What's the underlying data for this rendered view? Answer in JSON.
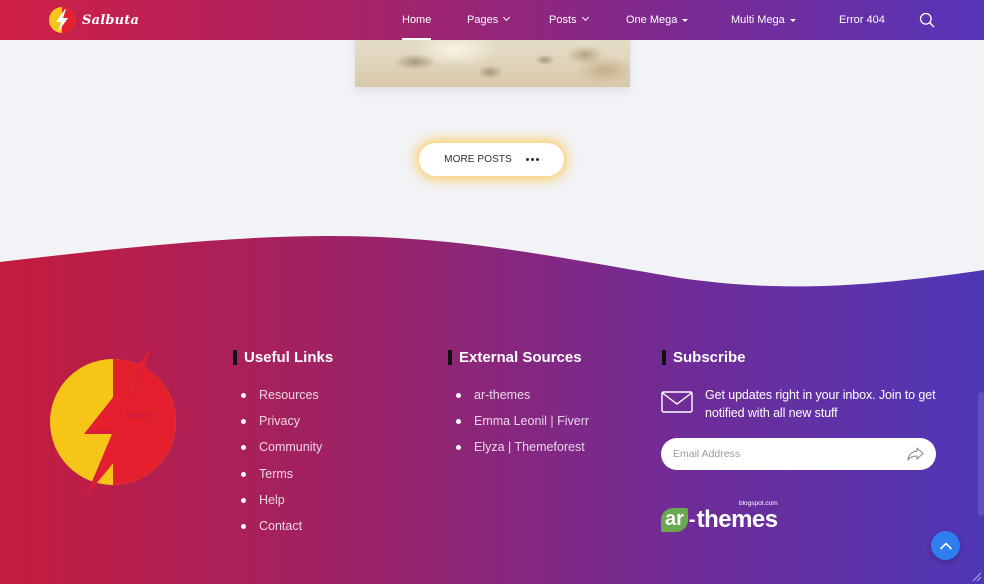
{
  "brand": {
    "name": "Salbuta"
  },
  "nav": {
    "items": [
      {
        "label": "Home"
      },
      {
        "label": "Pages"
      },
      {
        "label": "Posts"
      },
      {
        "label": "One Mega"
      },
      {
        "label": "Multi Mega"
      },
      {
        "label": "Error 404"
      }
    ],
    "search_icon": "search-icon"
  },
  "more_posts": {
    "label": "MORE POSTS",
    "icon": "more-dots-icon"
  },
  "footer": {
    "useful_links": {
      "title": "Useful Links",
      "items": [
        "Resources",
        "Privacy",
        "Community",
        "Terms",
        "Help",
        "Contact"
      ]
    },
    "external_sources": {
      "title": "External Sources",
      "items": [
        "ar-themes",
        "Emma Leonil | Fiverr",
        "Elyza | Themeforest"
      ]
    },
    "subscribe": {
      "title": "Subscribe",
      "text": "Get updates right in your inbox. Join to get notified with all new stuff",
      "email_placeholder": "Email Address",
      "icons": {
        "mail": "mail-icon",
        "send": "send-arrow-icon"
      }
    },
    "partner_logo": {
      "badge": "ar",
      "word": "themes",
      "domain": "blogspot.com"
    }
  },
  "colors": {
    "gradient_start": "#cf1f45",
    "gradient_end": "#5635b8",
    "accent_glow": "#ffbe28",
    "back_to_top": "#2f7ef0",
    "logo_yellow": "#f5c518",
    "logo_red": "#e4202f"
  }
}
